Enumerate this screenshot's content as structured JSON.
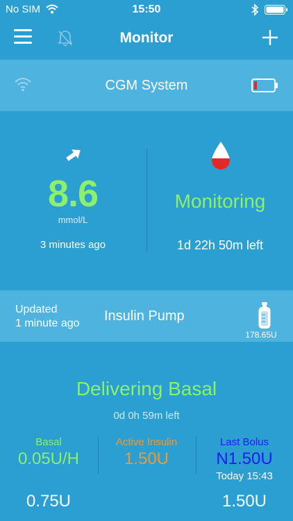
{
  "status_bar": {
    "carrier": "No SIM",
    "time": "15:50"
  },
  "nav": {
    "title": "Monitor"
  },
  "cgm": {
    "label": "CGM System",
    "battery_level": 0.15,
    "glucose_value": "8.6",
    "glucose_unit": "mmol/L",
    "updated_ago": "3 minutes ago",
    "state": "Monitoring",
    "time_left": "1d 22h 50m left"
  },
  "pump": {
    "updated_line1": "Updated",
    "updated_line2": "1 minute ago",
    "label": "Insulin Pump",
    "reservoir": "178.65U"
  },
  "delivery": {
    "status": "Delivering Basal",
    "time_left": "0d 0h 59m left",
    "basal_label": "Basal",
    "basal_value": "0.05U/H",
    "active_label": "Active Insulin",
    "active_value": "1.50U",
    "bolus_label": "Last Bolus",
    "bolus_value": "N1.50U",
    "bolus_time": "Today 15:43",
    "bottom_left": "0.75U",
    "bottom_right": "1.50U"
  },
  "colors": {
    "background": "#2b9fd2",
    "band": "#4fb3e0",
    "green": "#8cf06b",
    "orange": "#f09a2c",
    "blue": "#1a1ef0",
    "alert_red": "#e02a2a"
  },
  "icons": [
    "wifi-icon",
    "bluetooth-icon",
    "battery-icon",
    "menu-icon",
    "bell-off-icon",
    "plus-icon",
    "trend-arrow-icon",
    "blood-drop-icon",
    "insulin-bottle-icon"
  ]
}
